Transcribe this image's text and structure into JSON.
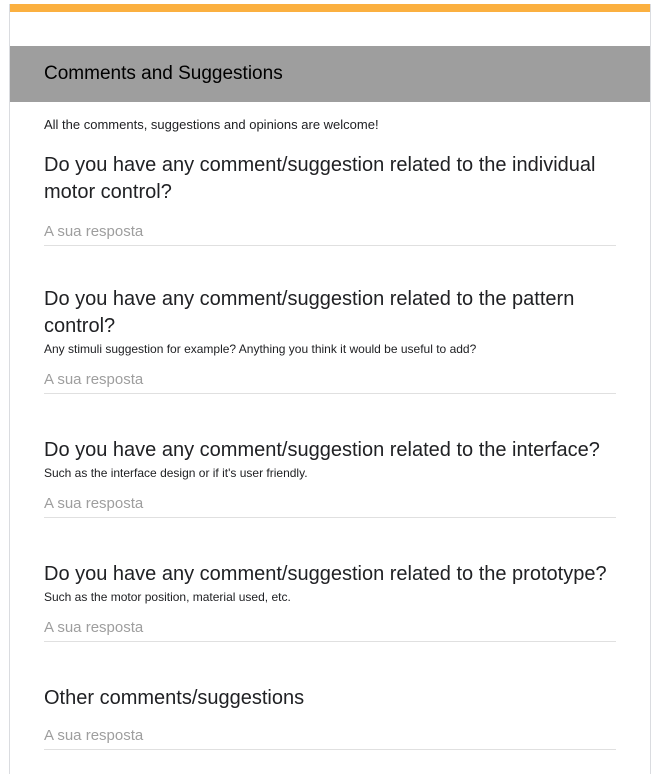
{
  "colors": {
    "accent": "#fbb040",
    "section_header_bg": "#9e9e9e"
  },
  "section": {
    "title": "Comments and Suggestions",
    "description": "All the comments, suggestions and opinions are welcome!"
  },
  "questions": [
    {
      "title": "Do you have any comment/suggestion related to the individual motor control?",
      "help": "",
      "placeholder": "A sua resposta"
    },
    {
      "title": "Do you have any comment/suggestion related to the pattern control?",
      "help": "Any stimuli suggestion for example? Anything you think it would be useful to add?",
      "placeholder": "A sua resposta"
    },
    {
      "title": "Do you have any comment/suggestion related to the interface?",
      "help": "Such as the interface design or if it's user friendly.",
      "placeholder": "A sua resposta"
    },
    {
      "title": "Do you have any comment/suggestion related to the prototype?",
      "help": "Such as the motor position, material used, etc.",
      "placeholder": "A sua resposta"
    },
    {
      "title": "Other comments/suggestions",
      "help": "",
      "placeholder": "A sua resposta"
    }
  ]
}
